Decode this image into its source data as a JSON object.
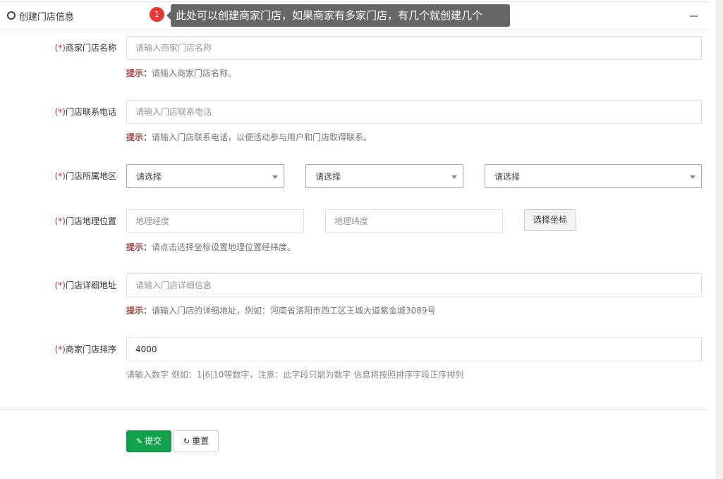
{
  "panel": {
    "title": "创建门店信息",
    "callout_badge": "1",
    "callout_text": "此处可以创建商家门店，如果商家有多家门店，有几个就创建几个"
  },
  "form": {
    "required_mark": "(*)",
    "store_name": {
      "label": "商家门店名称",
      "placeholder": "请输入商家门店名称",
      "hint_label": "提示：",
      "hint_text": "请输入商家门店名称。"
    },
    "phone": {
      "label": "门店联系电话",
      "placeholder": "请输入门店联系电话",
      "hint_label": "提示：",
      "hint_text": "请输入门店联系电话，以便活动参与用户和门店取得联系。"
    },
    "region": {
      "label": "门店所属地区",
      "selects": [
        "请选择",
        "请选择",
        "请选择"
      ]
    },
    "location": {
      "label": "门店地理位置",
      "longitude_placeholder": "地理经度",
      "latitude_placeholder": "地理纬度",
      "button": "选择坐标",
      "hint_label": "提示：",
      "hint_text": "请点击选择坐标设置地理位置经纬度。"
    },
    "address": {
      "label": "门店详细地址",
      "placeholder": "请输入门店详细信息",
      "hint_label": "提示：",
      "hint_text": "请输入门店的详细地址，例如：河南省洛阳市西工区王城大道紫金城3089号"
    },
    "sort": {
      "label": "商家门店排序",
      "value": "4000",
      "hint_text": "请输入数字 例如：1|6|10等数字，注意：此字段只能为数字 信息将按照排序字段正序排列"
    }
  },
  "actions": {
    "submit": "提交",
    "reset": "重置"
  },
  "icons": {
    "panel": "circle-icon",
    "collapse": "minus-icon",
    "submit": "pencil-icon",
    "reset": "refresh-icon"
  },
  "colors": {
    "submit_bg": "#10a14a",
    "hint_label": "#a94442",
    "callout_bg": "#666666",
    "badge": "#ea3535"
  }
}
